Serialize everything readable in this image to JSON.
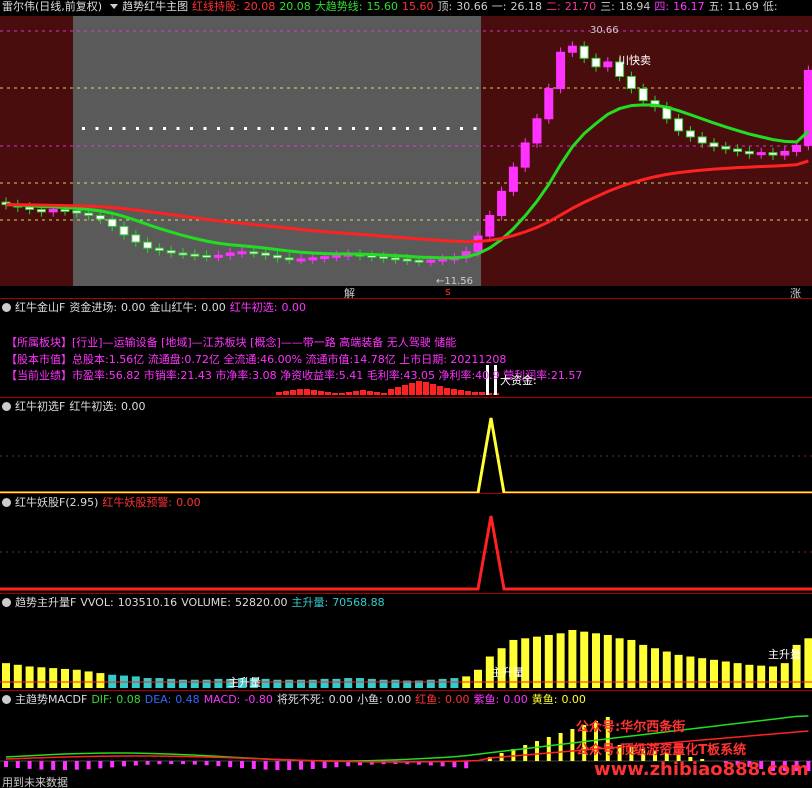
{
  "main": {
    "stock_name": "雷尔伟(日线,前复权)",
    "indicator": "趋势红牛主图",
    "hold_label": "红线持股:",
    "hold_v1": "20.08",
    "hold_v2": "20.08",
    "trend_label": "大趋势线:",
    "trend_v1": "15.60",
    "trend_v2": "15.60",
    "top_label": "顶:",
    "top_v": "30.66",
    "l1_label": "一:",
    "l1_v": "26.18",
    "l2_label": "二:",
    "l2_v": "21.70",
    "l3_label": "三:",
    "l3_v": "18.94",
    "l4_label": "四:",
    "l4_v": "16.17",
    "l5_label": "五:",
    "l5_v": "11.69",
    "low_label": "低:",
    "peak_label": "30.66",
    "low_price_label": "←11.56",
    "sell_label": "川快卖",
    "jie_label": "解",
    "s_label": "s",
    "zhang_label": "涨",
    "candles_close": [
      16.4,
      16.2,
      16.0,
      15.8,
      16.0,
      15.9,
      15.7,
      15.5,
      15.2,
      14.6,
      13.9,
      13.3,
      12.8,
      12.6,
      12.4,
      12.3,
      12.2,
      12.1,
      12.2,
      12.4,
      12.5,
      12.4,
      12.2,
      12.0,
      11.9,
      11.9,
      12.0,
      12.1,
      12.2,
      12.3,
      12.2,
      12.1,
      12.0,
      11.9,
      11.8,
      11.7,
      11.8,
      11.9,
      12.0,
      12.5,
      13.8,
      15.5,
      17.5,
      19.5,
      21.5,
      23.5,
      26.0,
      29.0,
      29.5,
      28.5,
      27.8,
      28.2,
      27.0,
      26.0,
      25.0,
      24.5,
      23.5,
      22.5,
      22.0,
      21.5,
      21.2,
      21.0,
      20.8,
      20.6,
      20.7,
      20.5,
      20.8,
      21.3,
      27.5
    ]
  },
  "jinshan": {
    "name": "红牛金山F",
    "l1": "资金进场:",
    "v1": "0.00",
    "l2": "金山红牛:",
    "v2": "0.00",
    "l3": "红牛初选:",
    "v3": "0.00",
    "info1": "【所属板块】[行业]—运输设备 [地域]—江苏板块 [概念]——带一路 高端装备 无人驾驶 储能",
    "info2": "【股本市值】总股本:1.56亿 流通盘:0.72亿 全流通:46.00% 流通市值:14.78亿 上市日期: 20211208",
    "info3": "【当前业绩】市盈率:56.82 市销率:21.43 市净率:3.08 净资收益率:5.41 毛利率:43.05 净利率:40.9 营利润率:21.57",
    "big_fund": "大资金:"
  },
  "chuxuan": {
    "name": "红牛初选F",
    "l1": "红牛初选:",
    "v1": "0.00"
  },
  "yaogu": {
    "name": "红牛妖股F(2.95)",
    "l1": "红牛妖股预警:",
    "v1": "0.00"
  },
  "volume": {
    "name": "趋势主升量F",
    "l1": "VVOL:",
    "v1": "103510.16",
    "l2": "VOLUME:",
    "v2": "52820.00",
    "l3": "主升量:",
    "v3": "70568.88",
    "label_a": "主升量",
    "label_b": "主升量",
    "label_c": "主升量",
    "vols": [
      30,
      28,
      26,
      25,
      24,
      23,
      22,
      20,
      18,
      16,
      15,
      14,
      12,
      12,
      11,
      10,
      10,
      10,
      11,
      11,
      12,
      12,
      11,
      10,
      10,
      10,
      10,
      11,
      11,
      12,
      12,
      11,
      10,
      10,
      9,
      9,
      10,
      11,
      12,
      14,
      22,
      38,
      48,
      58,
      60,
      62,
      64,
      66,
      70,
      68,
      66,
      64,
      60,
      58,
      52,
      48,
      44,
      40,
      38,
      36,
      34,
      32,
      30,
      28,
      27,
      26,
      30,
      52,
      60
    ]
  },
  "macd": {
    "name": "主趋势MACDF",
    "l1": "DIF:",
    "v1": "0.08",
    "l2": "DEA:",
    "v2": "0.48",
    "l3": "MACD:",
    "v3": "-0.80",
    "l4": "将死不死:",
    "v4": "0.00",
    "l5": "小鱼:",
    "v5": "0.00",
    "l6": "红鱼:",
    "v6": "0.00",
    "l7": "紫鱼:",
    "v7": "0.00",
    "l8": "黄鱼:",
    "v8": "0.00",
    "future": "用到未来数据",
    "wm1": "公众号:华尔西条街",
    "wm2": "公众号:顶级游资量化T板系统",
    "wm3": "www.zhibiao888.com"
  },
  "colors": {
    "up": "#ff33ff",
    "down": "#33cc33",
    "red": "#ff2222",
    "green": "#22dd22",
    "yellow": "#ffff33",
    "cyan": "#33cccc"
  }
}
